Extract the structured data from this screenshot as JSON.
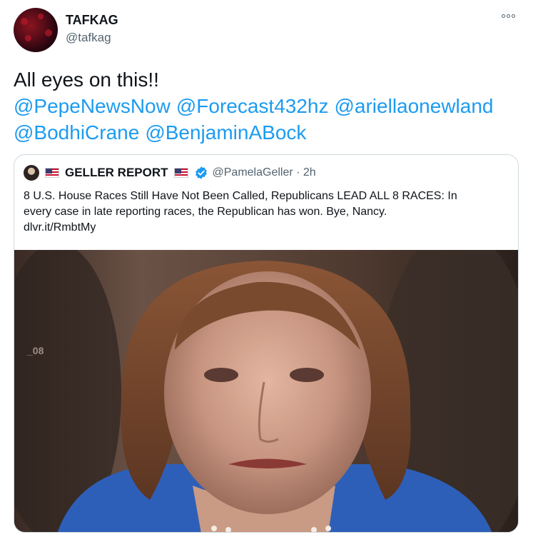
{
  "author": {
    "display_name": "TAFKAG",
    "handle": "@tafkag"
  },
  "tweet": {
    "line1": "All eyes on this!!",
    "mentions_line1": [
      "@PepeNewsNow",
      "@Forecast432hz",
      "@ariellaonewland"
    ],
    "mentions_line2": [
      "@BodhiCrane",
      "@BenjaminABock"
    ]
  },
  "quoted_tweet": {
    "display_name": "GELLER REPORT",
    "handle_time": "@PamelaGeller · 2h",
    "line1": "8 U.S. House Races Still Have Not Been Called, Republicans LEAD ALL 8 RACES: In",
    "line2": "every case in late reporting races, the Republican has won. Bye, Nancy.",
    "line3": "dlvr.it/RmbtMy",
    "image_label": "_08"
  },
  "icons": {
    "more": "more-options-icon",
    "verified": "verified-badge-icon",
    "flag": "us-flag-icon"
  },
  "colors": {
    "link": "#1d9bf0",
    "secondary_text": "#536471",
    "border": "#cfd9de"
  }
}
